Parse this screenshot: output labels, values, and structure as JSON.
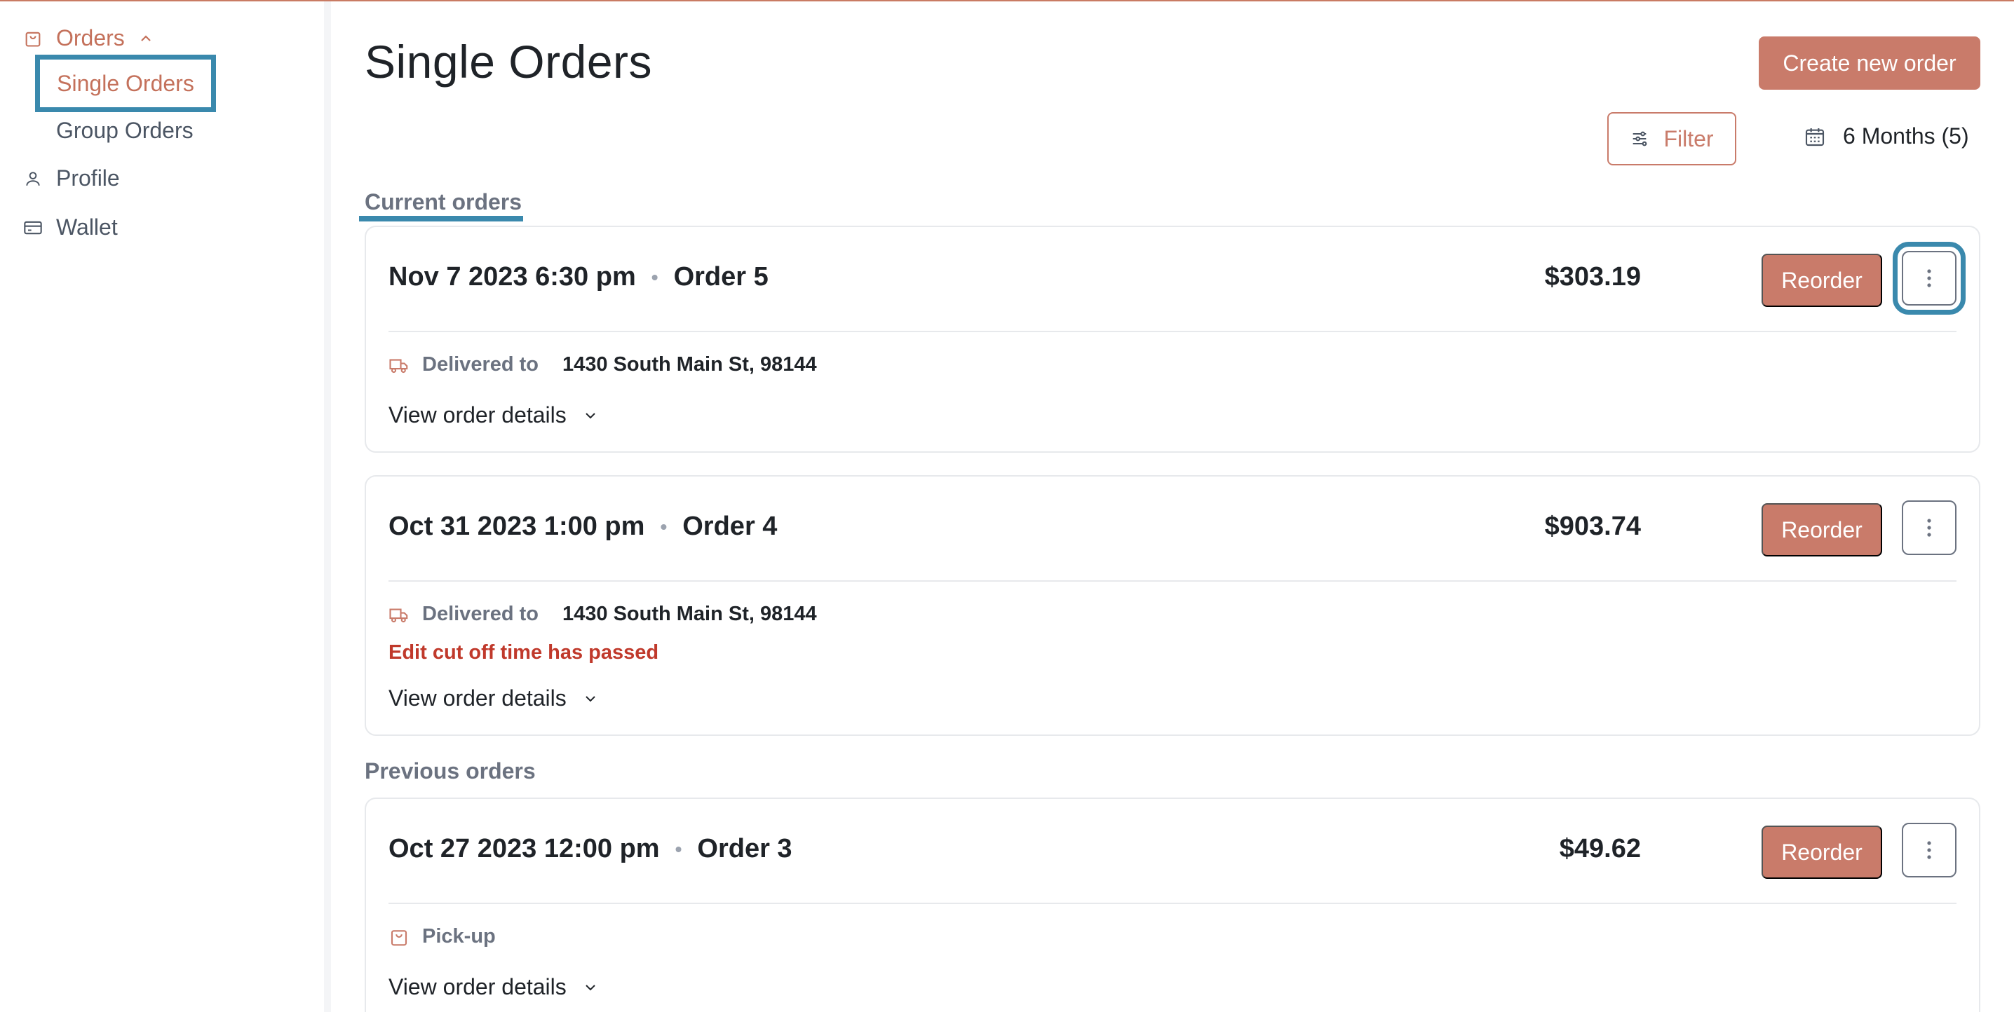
{
  "sidebar": {
    "orders_label": "Orders",
    "single_orders_label": "Single Orders",
    "group_orders_label": "Group Orders",
    "profile_label": "Profile",
    "wallet_label": "Wallet"
  },
  "header": {
    "title": "Single Orders",
    "create_button": "Create new order",
    "filter_button": "Filter",
    "date_range": "6 Months (5)"
  },
  "sections": {
    "current": "Current orders",
    "previous": "Previous orders"
  },
  "orders": [
    {
      "datetime": "Nov 7 2023 6:30 pm",
      "order": "Order 5",
      "price": "$303.19",
      "reorder": "Reorder",
      "method_label": "Delivered to",
      "address": "1430 South Main St, 98144",
      "warning": "",
      "details": "View order details"
    },
    {
      "datetime": "Oct 31 2023 1:00 pm",
      "order": "Order 4",
      "price": "$903.74",
      "reorder": "Reorder",
      "method_label": "Delivered to",
      "address": "1430 South Main St, 98144",
      "warning": "Edit cut off time has passed",
      "details": "View order details"
    },
    {
      "datetime": "Oct 27 2023 12:00 pm",
      "order": "Order 3",
      "price": "$49.62",
      "reorder": "Reorder",
      "method_label": "Pick-up",
      "address": "",
      "warning": "",
      "details": "View order details"
    }
  ],
  "colors": {
    "accent": "#c97b6a",
    "highlight": "#3a89ad",
    "warning": "#c0392b"
  }
}
